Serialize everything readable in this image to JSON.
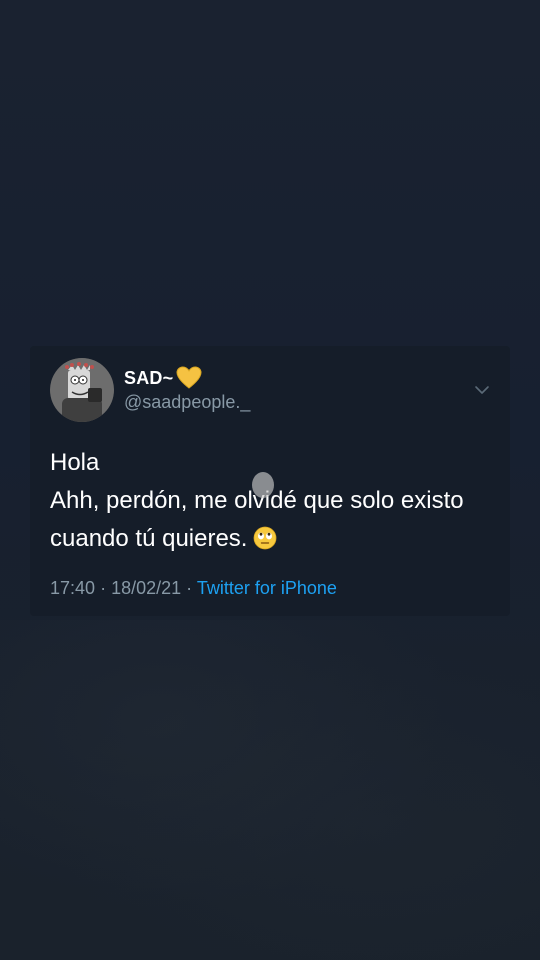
{
  "tweet": {
    "display_name": "SAD~",
    "handle": "@saadpeople._",
    "text_lines": [
      "Hola",
      "Ahh, perdón, me olvidé que solo existo",
      "cuando tú quieres."
    ],
    "time": "17:40",
    "separator": "·",
    "date": "18/02/21",
    "source": "Twitter for iPhone"
  },
  "icons": {
    "avatar": "avatar-icon",
    "heart": "yellow-heart-icon",
    "chevron": "chevron-down-icon",
    "emoji": "rolling-eyes-emoji-icon"
  },
  "colors": {
    "background": "#17202b",
    "card": "#151d29",
    "text": "#ffffff",
    "muted": "#8899a6",
    "link": "#1da1f2",
    "heart": "#f5c242"
  }
}
